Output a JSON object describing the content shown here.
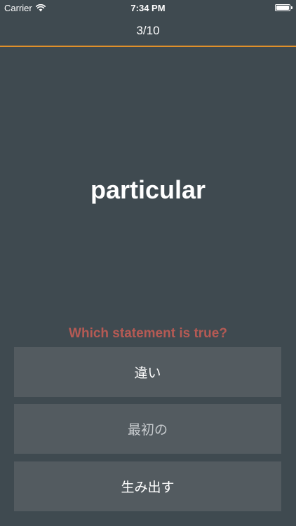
{
  "status_bar": {
    "carrier": "Carrier",
    "time": "7:34 PM",
    "battery_level": 1.0
  },
  "nav": {
    "progress": "3/10",
    "accent_color": "#e0902a"
  },
  "quiz": {
    "word": "particular",
    "prompt": "Which statement is true?",
    "prompt_color": "#b55a54",
    "answers": [
      {
        "label": "違い"
      },
      {
        "label": "最初の"
      },
      {
        "label": "生み出す"
      }
    ]
  },
  "colors": {
    "background": "#3f4a50",
    "button": "#535b60"
  },
  "icons": [
    "wifi-icon",
    "battery-icon"
  ]
}
